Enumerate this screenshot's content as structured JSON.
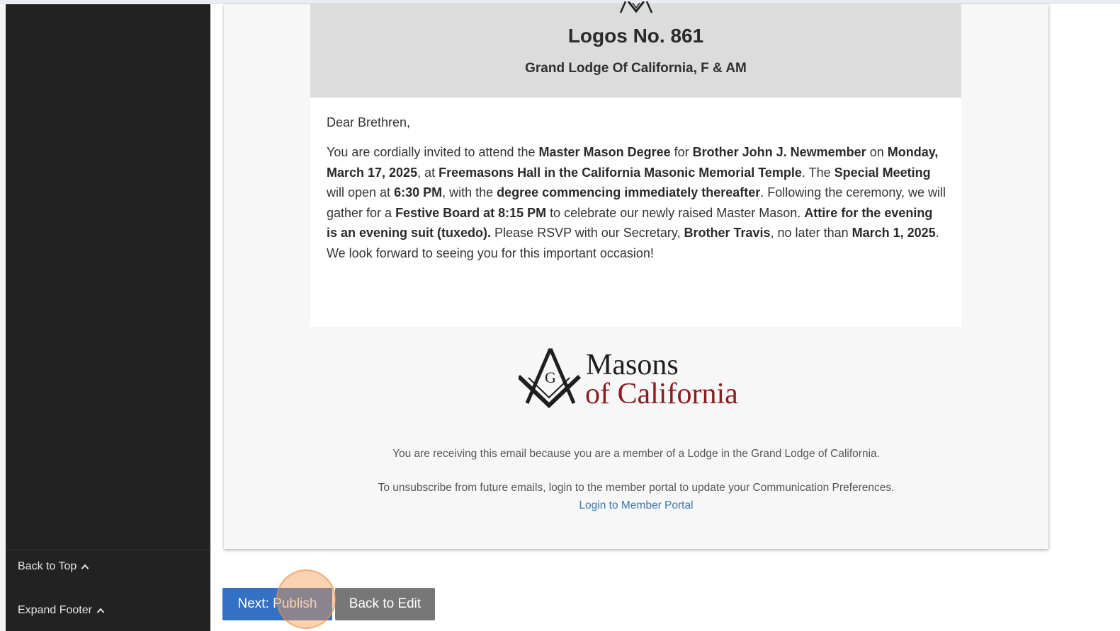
{
  "sidebar": {
    "back_to_top": "Back to Top",
    "expand_footer": "Expand Footer"
  },
  "email": {
    "lodge_name": "Logos No. 861",
    "grand_lodge": "Grand Lodge Of California, F & AM",
    "greeting": "Dear Brethren,",
    "letter": {
      "t1": "You are cordially invited to attend the ",
      "b1": "Master Mason Degree",
      "t2": " for ",
      "b2": "Brother John J. Newmember",
      "t3": " on ",
      "b3": "Monday, March 17, 2025",
      "t4": ", at ",
      "b4": "Freemasons Hall in the California Masonic Memorial Temple",
      "t5": ". The ",
      "b5": "Special Meeting",
      "t6": " will open at ",
      "b6": "6:30 PM",
      "t7": ", with the ",
      "b7": "degree commencing immediately thereafter",
      "t8": ". Following the ceremony, we will gather for a ",
      "b8": "Festive Board at 8:15 PM",
      "t9": " to celebrate our newly raised Master Mason. ",
      "b9": "Attire for the evening is an evening suit (tuxedo).",
      "t10": " Please RSVP with our Secretary, ",
      "b10": "Brother Travis",
      "t11": ", no later than ",
      "b11": "March 1, 2025",
      "t12": ". We look forward to seeing you for this important occasion!"
    },
    "logo": {
      "line1": "Masons",
      "line2": "of California",
      "emblem_letter": "G"
    },
    "footer": {
      "notice": "You are receiving this email because you are a member of a Lodge in the Grand Lodge of California.",
      "unsubscribe": "To unsubscribe from future emails, login to the member portal to update your Communication Preferences.",
      "portal_link": "Login to Member Portal"
    }
  },
  "actions": {
    "publish": "Next: Publish",
    "edit": "Back to Edit"
  },
  "colors": {
    "sidebar": "#222222",
    "primary_button": "#3371c4",
    "secondary_button": "#777777",
    "brand_red": "#8b1c1f",
    "link": "#3a78b8"
  },
  "icons": {
    "back_to_top": "chevron-up-icon",
    "expand_footer": "chevron-up-icon",
    "emblem": "square-and-compasses-icon"
  }
}
